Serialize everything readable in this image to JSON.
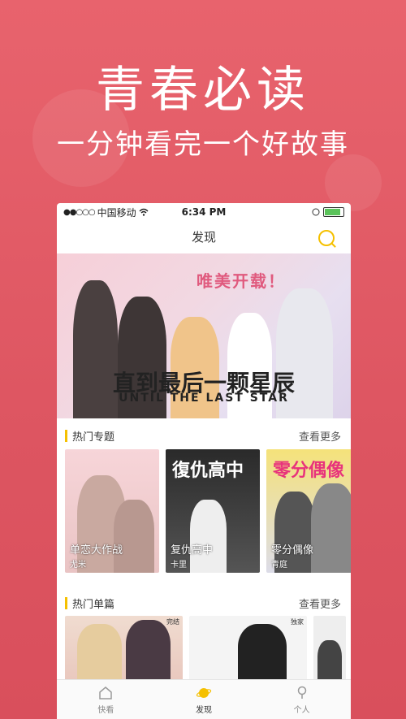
{
  "hero": {
    "title": "青春必读",
    "subtitle": "一分钟看完一个好故事"
  },
  "status": {
    "carrier": "中国移动",
    "time": "6:34 PM"
  },
  "nav": {
    "title": "发现"
  },
  "banner": {
    "tag": "唯美开载！",
    "title_cn": "直到最后一颗星辰",
    "title_en": "UNTIL THE LAST STAR"
  },
  "section1": {
    "title": "热门专题",
    "more": "查看更多",
    "cards": [
      {
        "title": "单恋大作战",
        "author": "尤米"
      },
      {
        "title": "复仇高中",
        "author": "卡里",
        "overlay": "復仇高中"
      },
      {
        "title": "零分偶像",
        "author": "青庭",
        "overlay": "零分偶像"
      }
    ]
  },
  "section2": {
    "title": "热门单篇",
    "more": "查看更多",
    "badges": [
      "完结",
      "独家"
    ]
  },
  "tabs": [
    {
      "label": "快看",
      "icon": "home-icon"
    },
    {
      "label": "发现",
      "icon": "planet-icon"
    },
    {
      "label": "个人",
      "icon": "person-icon"
    }
  ],
  "colors": {
    "brand": "#dd5561",
    "accent": "#f5c000"
  }
}
